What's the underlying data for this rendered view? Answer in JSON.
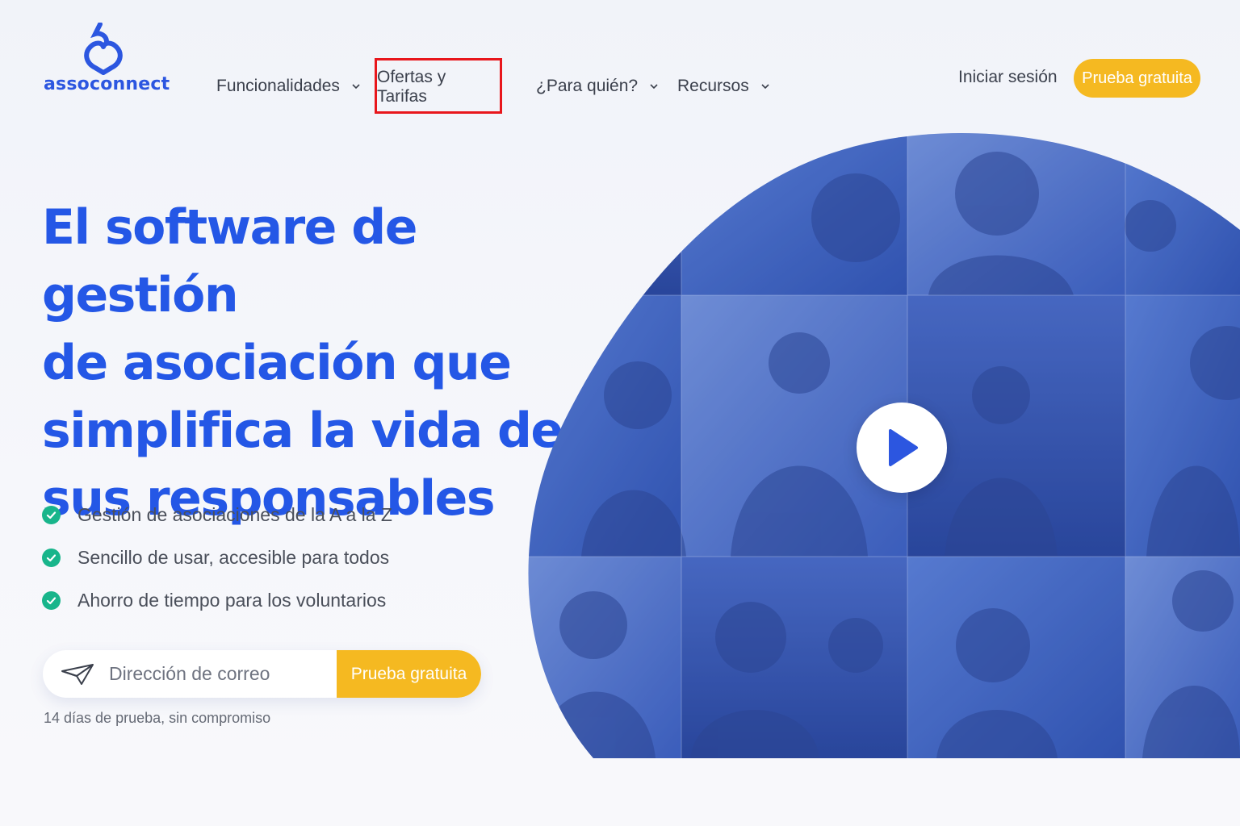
{
  "brand": {
    "name": "assoconnect",
    "accent": "#2c56e0",
    "cta_color": "#f5b921",
    "check_color": "#18b58b",
    "highlight_color": "#e8161c"
  },
  "nav": {
    "items": [
      {
        "label": "Funcionalidades",
        "has_dropdown": true,
        "icon": "chevron-down-icon"
      },
      {
        "label": "Ofertas y Tarifas",
        "has_dropdown": false,
        "highlighted": true
      },
      {
        "label": "¿Para quién?",
        "has_dropdown": true,
        "icon": "chevron-down-icon"
      },
      {
        "label": "Recursos",
        "has_dropdown": true,
        "icon": "chevron-down-icon"
      }
    ],
    "login_label": "Iniciar sesión",
    "cta_label": "Prueba gratuita"
  },
  "hero": {
    "title_lines": [
      "El software de gestión",
      "de asociación que",
      "simplifica la vida de",
      "sus responsables"
    ],
    "features": [
      "Gestión de asociaciones de la A a la Z",
      "Sencillo de usar, accesible para todos",
      "Ahorro de tiempo para los voluntarios"
    ],
    "email": {
      "placeholder": "Dirección de correo",
      "value": "",
      "icon": "paper-plane-icon"
    },
    "cta_label": "Prueba gratuita",
    "note": "14 días de prueba, sin compromiso"
  },
  "media": {
    "icon": "play-icon",
    "tint": "#3a62d0"
  }
}
